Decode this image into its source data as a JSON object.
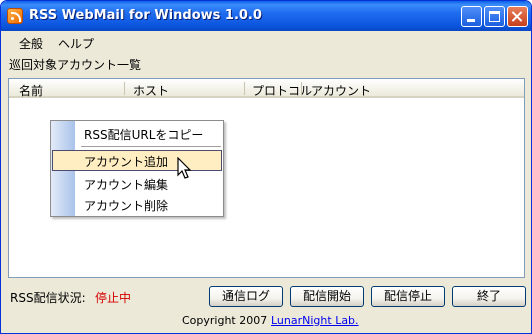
{
  "window": {
    "title": "RSS WebMail for Windows 1.0.0",
    "icon": "rss-feed-icon"
  },
  "menu": {
    "items": [
      "全般",
      "ヘルプ"
    ]
  },
  "section_label": "巡回対象アカウント一覧",
  "list": {
    "columns": [
      "名前",
      "ホスト",
      "プロトコル",
      "アカウント"
    ],
    "rows": []
  },
  "context_menu": {
    "items": [
      "RSS配信URLをコピー",
      "アカウント追加",
      "アカウント編集",
      "アカウント削除"
    ],
    "highlighted": "アカウント追加"
  },
  "status": {
    "label": "RSS配信状況:",
    "value": "停止中",
    "value_color": "#d40000"
  },
  "buttons": {
    "log": "通信ログ",
    "start": "配信開始",
    "stop": "配信停止",
    "exit": "終了"
  },
  "footer": {
    "copyright": "Copyright 2007",
    "company": "LunarNight Lab."
  },
  "colors": {
    "titlebar": "#0b54dc",
    "menu_highlight": "#ffeec2",
    "link": "#0000ee"
  }
}
